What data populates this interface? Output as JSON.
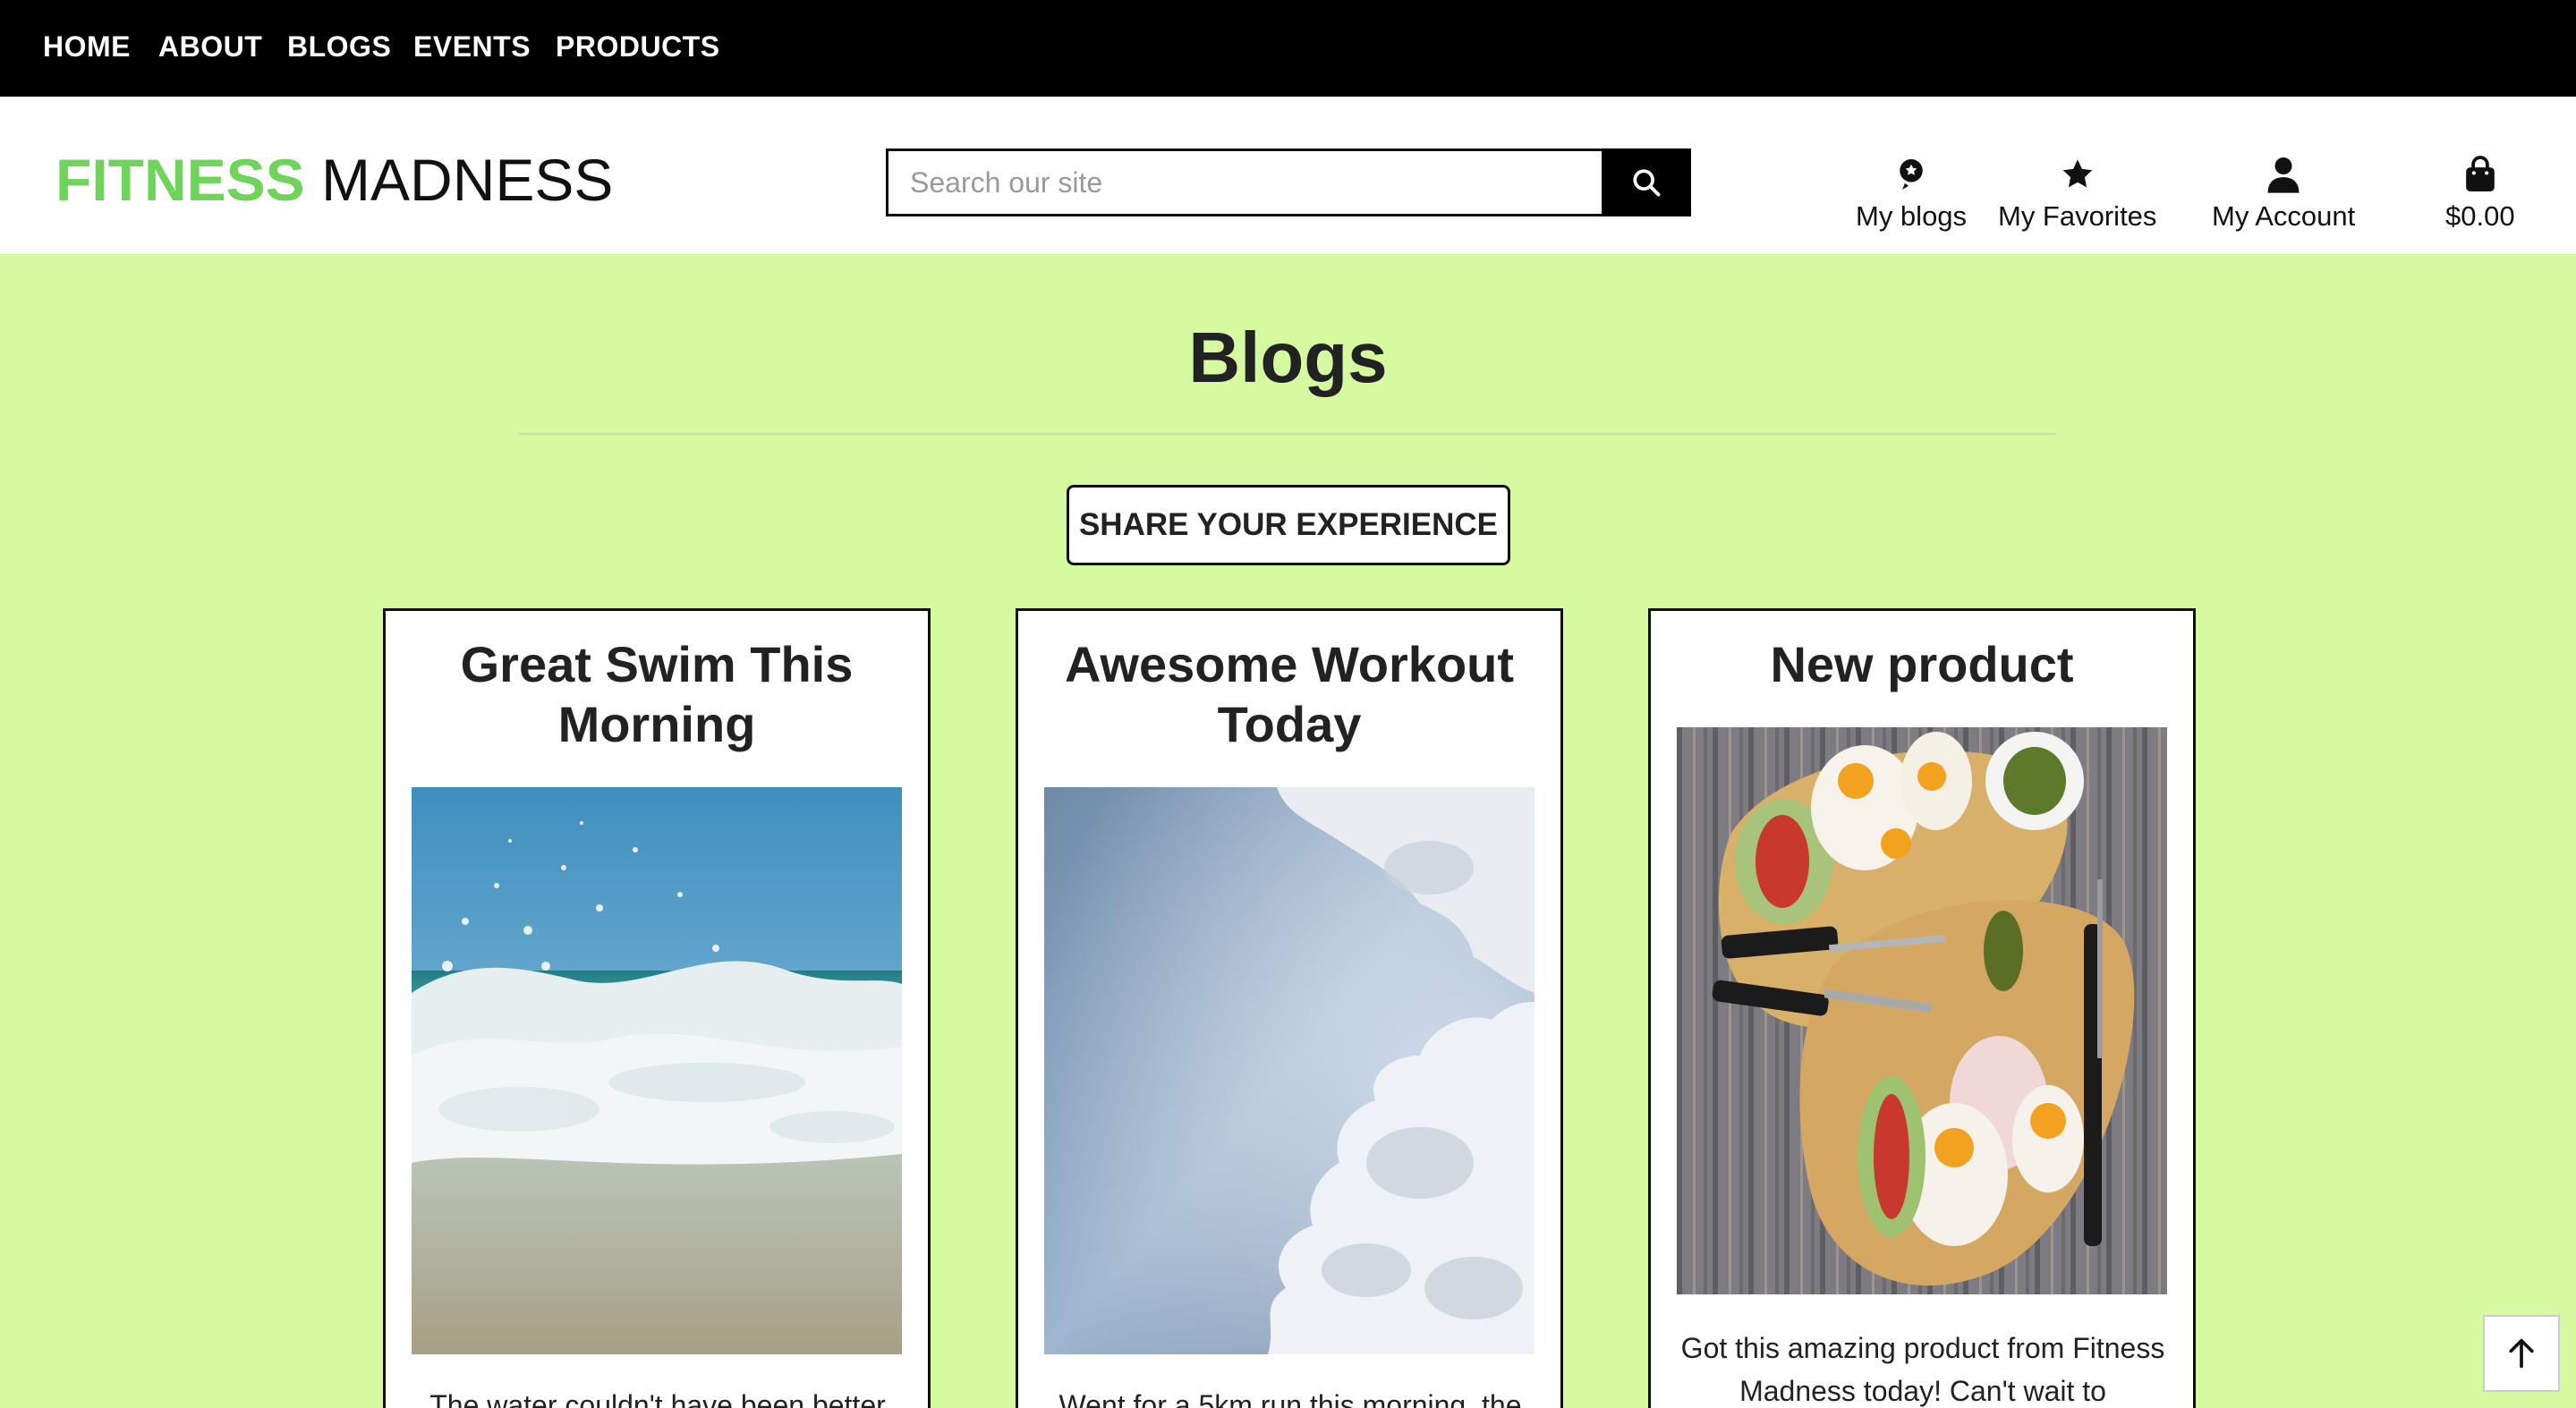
{
  "topnav": {
    "items": [
      "HOME",
      "ABOUT",
      "BLOGS",
      "EVENTS",
      "PRODUCTS"
    ]
  },
  "header": {
    "logo_part1": "FITNESS",
    "logo_part2": "MADNESS",
    "search": {
      "placeholder": "Search our site",
      "value": "",
      "icon": "search-icon"
    },
    "links": [
      {
        "label": "My blogs",
        "icon": "blog-badge-icon"
      },
      {
        "label": "My Favorites",
        "icon": "star-icon"
      },
      {
        "label": "My Account",
        "icon": "user-icon"
      },
      {
        "label": "$0.00",
        "icon": "shopping-bag-icon"
      }
    ]
  },
  "main": {
    "title": "Blogs",
    "share_button": "SHARE YOUR EXPERIENCE",
    "cards": [
      {
        "title": "Great Swim This Morning",
        "image": "ocean-wave-photo",
        "text": "The water couldn't have been better"
      },
      {
        "title": "Awesome Workout Today",
        "image": "sky-clouds-photo",
        "text": "Went for a 5km run this morning, the"
      },
      {
        "title": "New product",
        "image": "breakfast-board-photo",
        "text": "Got this amazing product from Fitness Madness today! Can't wait to"
      }
    ]
  },
  "scroll_top": {
    "icon": "arrow-up-icon"
  },
  "colors": {
    "accent_green": "#6fd45a",
    "page_background": "#d5fa9f",
    "nav_background": "#000000"
  }
}
